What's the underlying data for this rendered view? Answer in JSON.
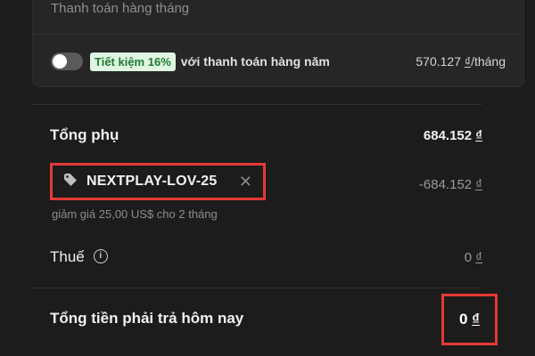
{
  "billing": {
    "monthly_label": "Thanh toán hàng tháng",
    "annual_toggle": {
      "on": false
    },
    "savings_badge": "Tiết kiệm 16%",
    "annual_text": "với thanh toán hàng năm",
    "annual_price_amount": "570.127",
    "annual_price_currency": "₫",
    "annual_price_period": "/tháng"
  },
  "summary": {
    "subtotal_label": "Tổng phụ",
    "subtotal_amount": "684.152",
    "currency": "₫",
    "promo_code": "NEXTPLAY-LOV-25",
    "promo_discount_amount": "-684.152",
    "promo_note": "giảm giá 25,00 US$ cho 2 tháng",
    "tax_label": "Thuế",
    "tax_amount": "0",
    "total_label": "Tổng tiền phải trả hôm nay",
    "total_amount": "0"
  },
  "icons": {
    "tag": "tag-icon",
    "remove": "close-icon",
    "info": "info-icon"
  },
  "colors": {
    "background": "#1c1c1c",
    "highlight": "#e53935",
    "badge_bg": "#dff5e1",
    "badge_text": "#1f7a33"
  }
}
